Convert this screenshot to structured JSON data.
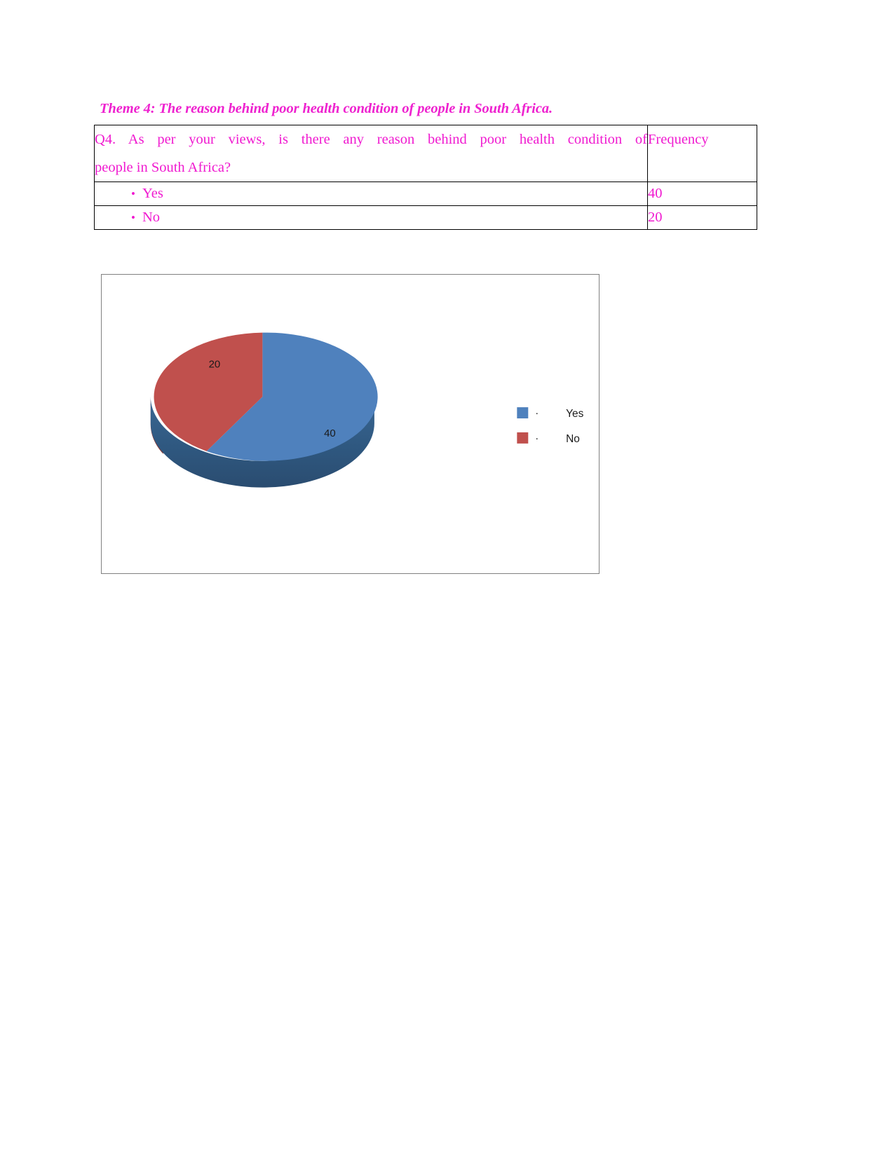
{
  "document": {
    "theme_title": "Theme 4: The reason behind poor health condition of people in South Africa.",
    "title_color": "#ee21cf",
    "text_color": "#f01ad0"
  },
  "table": {
    "question_line1": "Q4. As per your views, is there any reason behind poor health condition of",
    "question_line2": "people in South Africa?",
    "frequency_header": "Frequency",
    "rows": [
      {
        "bullet": "•",
        "label": "Yes",
        "value": "40"
      },
      {
        "bullet": "•",
        "label": "No",
        "value": "20"
      }
    ]
  },
  "chart_data": {
    "type": "pie",
    "title": "",
    "categories": [
      "Yes",
      "No"
    ],
    "values": [
      40,
      20
    ],
    "data_labels": [
      "40",
      "20"
    ],
    "legend": [
      {
        "label": "Yes",
        "color": "#4f81bd",
        "bullet": "·"
      },
      {
        "label": "No",
        "color": "#c0504d",
        "bullet": "·"
      }
    ],
    "legend_position": "right",
    "three_d": true,
    "colors": [
      "#4f81bd",
      "#c0504d"
    ],
    "side_colors": [
      "#2d5479",
      "#8c3a38"
    ],
    "grid": false,
    "frame_color": "#808080"
  }
}
